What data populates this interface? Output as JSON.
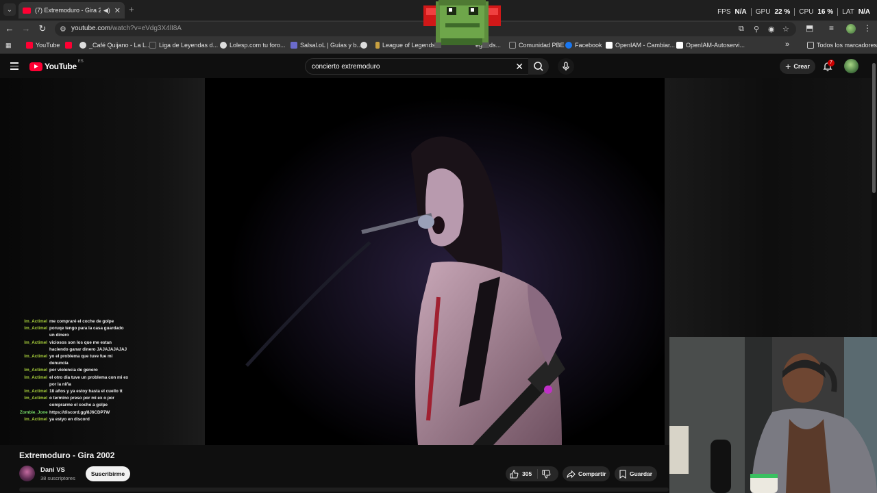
{
  "browser": {
    "tab": {
      "title": "(7) Extremoduro - Gira 2002",
      "close": "✕"
    },
    "new_tab": "+",
    "omnibox": {
      "host": "youtube.com",
      "path": "/watch?v=eVdg3X4lI8A"
    },
    "bookmarks": [
      {
        "label": "YouTube",
        "icon_color": "#ff0033"
      },
      {
        "label": "",
        "icon_color": "#ff0033"
      },
      {
        "label": "_Café Quijano - La L...",
        "icon_color": "#dddddd"
      },
      {
        "label": "Liga de Leyendas d...",
        "icon_color": "#333333"
      },
      {
        "label": "Lolesp.com tu foro...",
        "icon_color": "#dddddd"
      },
      {
        "label": "Salsal.oL | Guías y b...",
        "icon_color": "#6b6bcc"
      },
      {
        "label": "",
        "icon_color": "#dddddd"
      },
      {
        "label": "League of Legends",
        "icon_color": "#c8a040"
      },
      {
        "label": "egends...",
        "icon_color": "#2b2b2b"
      },
      {
        "label": "Comunidad PBE",
        "icon_color": "#333333"
      },
      {
        "label": "Facebook",
        "icon_color": "#1877f2"
      },
      {
        "label": "OpenIAM - Cambiar...",
        "icon_color": "#ffffff"
      },
      {
        "label": "OpenIAM-Autoservi...",
        "icon_color": "#ffffff"
      }
    ],
    "bookmarks_more": "»",
    "all_bookmarks": "Todos los marcadores"
  },
  "overlay_stats": [
    {
      "label": "FPS",
      "value": "N/A"
    },
    {
      "label": "GPU",
      "value": "22 %"
    },
    {
      "label": "CPU",
      "value": "16 %"
    },
    {
      "label": "LAT",
      "value": "N/A"
    }
  ],
  "youtube": {
    "logo_text": "YouTube",
    "logo_region": "ES",
    "search_query": "concierto extremoduro",
    "create_label": "Crear",
    "notification_count": "7",
    "video": {
      "title": "Extremoduro - Gira 2002",
      "channel": "Dani VS",
      "subscribers": "38 suscriptores",
      "subscribe_label": "Suscribirme",
      "likes": "305",
      "share_label": "Compartir",
      "save_label": "Guardar"
    }
  },
  "chat": [
    {
      "user": "Im_Actimel",
      "text": "me compraré el coche de golpe"
    },
    {
      "user": "Im_Actimel",
      "text": "poruqe tengo para la casa guardado un dinero"
    },
    {
      "user": "Im_Actimel",
      "text": "viciosos son los que me estan haciendo ganar dinero JAJAJAJAJAJ"
    },
    {
      "user": "Im_Actimel",
      "text": "yo el problema que tuve fue mi denuncia"
    },
    {
      "user": "Im_Actimel",
      "text": "por violencia de genero"
    },
    {
      "user": "Im_Actimel",
      "text": "el otro dia tuve un problema con mi ex por la niña"
    },
    {
      "user": "Im_Actimel",
      "text": "18 años y ya estoy hasta el cuello tt"
    },
    {
      "user": "Im_Actimel",
      "text": "o termino preso por mi ex o por comprarme el coche a golpe"
    },
    {
      "user": "Zombie_Jone",
      "text": "https://discord.gg/8J6CDP7W"
    },
    {
      "user": "Im_Actimel",
      "text": "ya estyo en discord"
    }
  ],
  "colors": {
    "youtube_red": "#ff0033",
    "chat_user": "#a9d13c",
    "chat_user_alt": "#7be36b"
  }
}
